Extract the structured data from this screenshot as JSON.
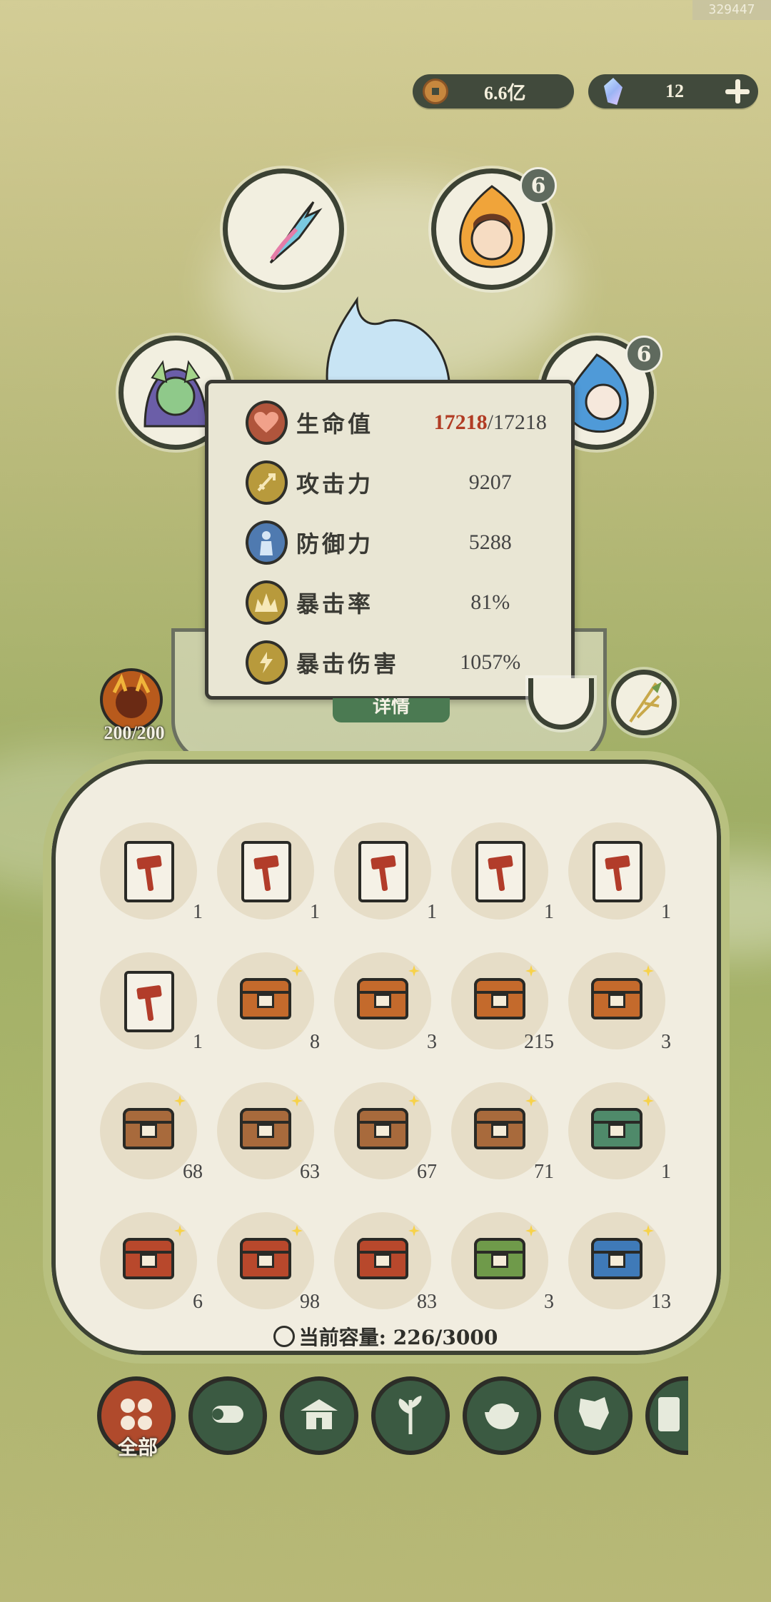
{
  "corner_id": "329447",
  "currency": {
    "coins": "6.6亿",
    "gems": "12"
  },
  "equip_slots": {
    "top_right_badge": "6",
    "right_badge": "6"
  },
  "stats": [
    {
      "label": "生命值",
      "current": "17218",
      "max": "/17218",
      "icon": "heart-icon",
      "color": "#b0553c"
    },
    {
      "label": "攻击力",
      "value": "9207",
      "icon": "sword-icon",
      "color": "#b89a3c"
    },
    {
      "label": "防御力",
      "value": "5288",
      "icon": "person-shield-icon",
      "color": "#4f7ab0"
    },
    {
      "label": "暴击率",
      "value": "81%",
      "icon": "crit-rate-icon",
      "color": "#b89a3c"
    },
    {
      "label": "暴击伤害",
      "value": "1057%",
      "icon": "crit-damage-icon",
      "color": "#b89a3c"
    }
  ],
  "detail_button": "详情",
  "stamina": "200/200",
  "inventory": [
    {
      "type": "hammer-card",
      "count": "1"
    },
    {
      "type": "hammer-card",
      "count": "1"
    },
    {
      "type": "hammer-card",
      "count": "1"
    },
    {
      "type": "hammer-card",
      "count": "1"
    },
    {
      "type": "hammer-card",
      "count": "1"
    },
    {
      "type": "hammer-card",
      "count": "1"
    },
    {
      "type": "orange-chest",
      "count": "8"
    },
    {
      "type": "orange-chest",
      "count": "3"
    },
    {
      "type": "orange-chest",
      "count": "215"
    },
    {
      "type": "orange-chest",
      "count": "3"
    },
    {
      "type": "brown-chest",
      "count": "68"
    },
    {
      "type": "brown-chest",
      "count": "63"
    },
    {
      "type": "brown-chest",
      "count": "67"
    },
    {
      "type": "brown-chest",
      "count": "71"
    },
    {
      "type": "green-chest",
      "count": "1"
    },
    {
      "type": "red-chest",
      "count": "6"
    },
    {
      "type": "red-chest",
      "count": "98"
    },
    {
      "type": "red-chest",
      "count": "83"
    },
    {
      "type": "bamboo-chest",
      "count": "3"
    },
    {
      "type": "blue-chest",
      "count": "13"
    }
  ],
  "capacity": "当前容量: 226/3000",
  "categories": [
    {
      "label": "全部",
      "icon": "all-icon",
      "active": true
    },
    {
      "label": "",
      "icon": "wood-icon"
    },
    {
      "label": "",
      "icon": "house-icon"
    },
    {
      "label": "",
      "icon": "herb-icon"
    },
    {
      "label": "",
      "icon": "rice-bowl-icon"
    },
    {
      "label": "",
      "icon": "ore-icon"
    },
    {
      "label": "",
      "icon": "scroll-icon"
    }
  ],
  "colors": {
    "orange-chest": "#c46a2c",
    "brown-chest": "#a86a3c",
    "green-chest": "#4f8a6a",
    "red-chest": "#b8482c",
    "bamboo-chest": "#6f9a4a",
    "blue-chest": "#3f7ab8"
  }
}
